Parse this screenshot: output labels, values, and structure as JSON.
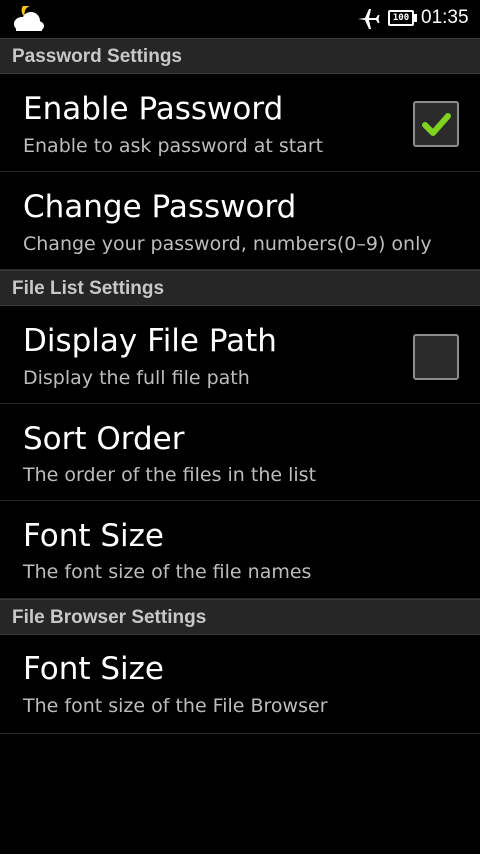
{
  "status_bar": {
    "time": "01:35",
    "battery": "100",
    "icons": [
      "weather-cloud-moon-icon",
      "airplane-mode-icon",
      "battery-icon"
    ]
  },
  "sections": [
    {
      "header": "Password Settings",
      "items": [
        {
          "title": "Enable Password",
          "summary": "Enable to ask password at start",
          "checkbox": true,
          "checked": true
        },
        {
          "title": "Change Password",
          "summary": "Change your password, numbers(0–9) only"
        }
      ]
    },
    {
      "header": "File List Settings",
      "items": [
        {
          "title": "Display File Path",
          "summary": "Display the full file path",
          "checkbox": true,
          "checked": false
        },
        {
          "title": "Sort Order",
          "summary": "The order of the files in the list"
        },
        {
          "title": "Font Size",
          "summary": "The font size of the file names"
        }
      ]
    },
    {
      "header": "File Browser Settings",
      "items": [
        {
          "title": "Font Size",
          "summary": "The font size of the File Browser"
        }
      ]
    }
  ],
  "colors": {
    "background": "#000000",
    "header_bg": "#262626",
    "check_green": "#7ed321"
  }
}
